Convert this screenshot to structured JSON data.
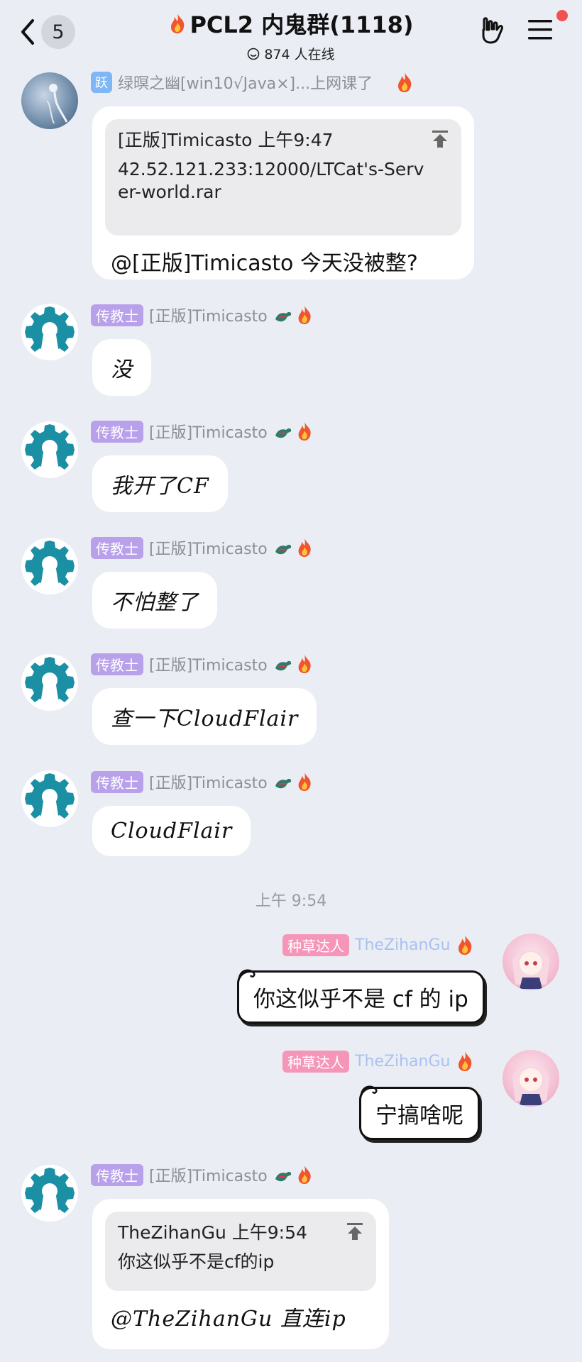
{
  "header": {
    "unread_count": "5",
    "group_title": "PCL2 内鬼群(1118)",
    "online_text": "874 人在线"
  },
  "messages": [
    {
      "sender": "绿暝之幽[win10√Java×]...上网课了",
      "level_tag": "跃",
      "quote_header": "[正版]Timicasto 上午9:47",
      "quote_text": "42.52.121.233:12000/LTCat's-Server-world.rar",
      "text": "@[正版]Timicasto 今天没被整?"
    },
    {
      "role": "传教士",
      "sender": "[正版]Timicasto",
      "text": "没"
    },
    {
      "role": "传教士",
      "sender": "[正版]Timicasto",
      "text": "我开了CF"
    },
    {
      "role": "传教士",
      "sender": "[正版]Timicasto",
      "text": "不怕整了"
    },
    {
      "role": "传教士",
      "sender": "[正版]Timicasto",
      "text": "查一下CloudFlair"
    },
    {
      "role": "传教士",
      "sender": "[正版]Timicasto",
      "text": "CloudFlair"
    },
    {
      "role": "种草达人",
      "sender": "TheZihanGu",
      "text": "你这似乎不是 cf 的 ip"
    },
    {
      "role": "种草达人",
      "sender": "TheZihanGu",
      "text": "宁搞啥呢"
    },
    {
      "role": "传教士",
      "sender": "[正版]Timicasto",
      "quote_header": "TheZihanGu 上午9:54",
      "quote_text": "你这似乎不是cf的ip",
      "text": "@TheZihanGu 直连ip"
    }
  ],
  "time_separator": "上午 9:54",
  "colors": {
    "background": "#eaedf4",
    "role_tag_purple": "#b8a0ea",
    "role_tag_pink": "#f596b9",
    "avatar_gear": "#1b8fa3",
    "notification_dot": "#f2524f"
  },
  "icons": [
    "chevron-left-icon",
    "fire-icon",
    "online-icon",
    "rock-hand-icon",
    "menu-icon",
    "pin-top-icon",
    "gear-avatar-icon"
  ]
}
